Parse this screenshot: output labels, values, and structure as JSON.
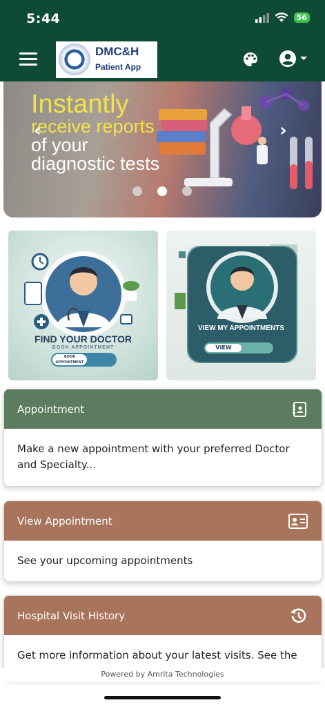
{
  "status_bar": {
    "time": "5:44",
    "battery": "56",
    "battery_color": "#3ec24f"
  },
  "app_bar": {
    "background": "#0f4a34",
    "logo_title": "DMC&H",
    "logo_subtitle": "Patient App",
    "icons": [
      "menu-icon",
      "palette-icon",
      "account-icon",
      "dropdown-icon"
    ]
  },
  "banner": {
    "line1": "Instantly",
    "line2": "receive reports",
    "line3": "of your",
    "line4": "diagnostic tests",
    "prev_arrow": "‹",
    "next_arrow": "›",
    "slide_count": 3,
    "active_slide": 2
  },
  "tiles": {
    "find_doctor": {
      "title": "FIND YOUR DOCTOR",
      "subtitle": "BOOK APPOINTMENT",
      "button": "BOOK APPOINTMENT"
    },
    "view_appointments": {
      "title": "VIEW MY APPOINTMENTS",
      "button": "VIEW"
    }
  },
  "cards": [
    {
      "title": "Appointment",
      "description": "Make a new appointment with your preferred Doctor and Specialty...",
      "color": "#5d7b5f",
      "icon": "contact-book-icon"
    },
    {
      "title": "View Appointment",
      "description": "See your upcoming appointments",
      "color": "#a8745c",
      "icon": "id-card-icon"
    },
    {
      "title": "Hospital Visit History",
      "description": "Get more information about your latest visits. See the",
      "color": "#a8745c",
      "icon": "history-icon"
    }
  ],
  "footer": {
    "text": "Powered by Amrita Technologies"
  }
}
